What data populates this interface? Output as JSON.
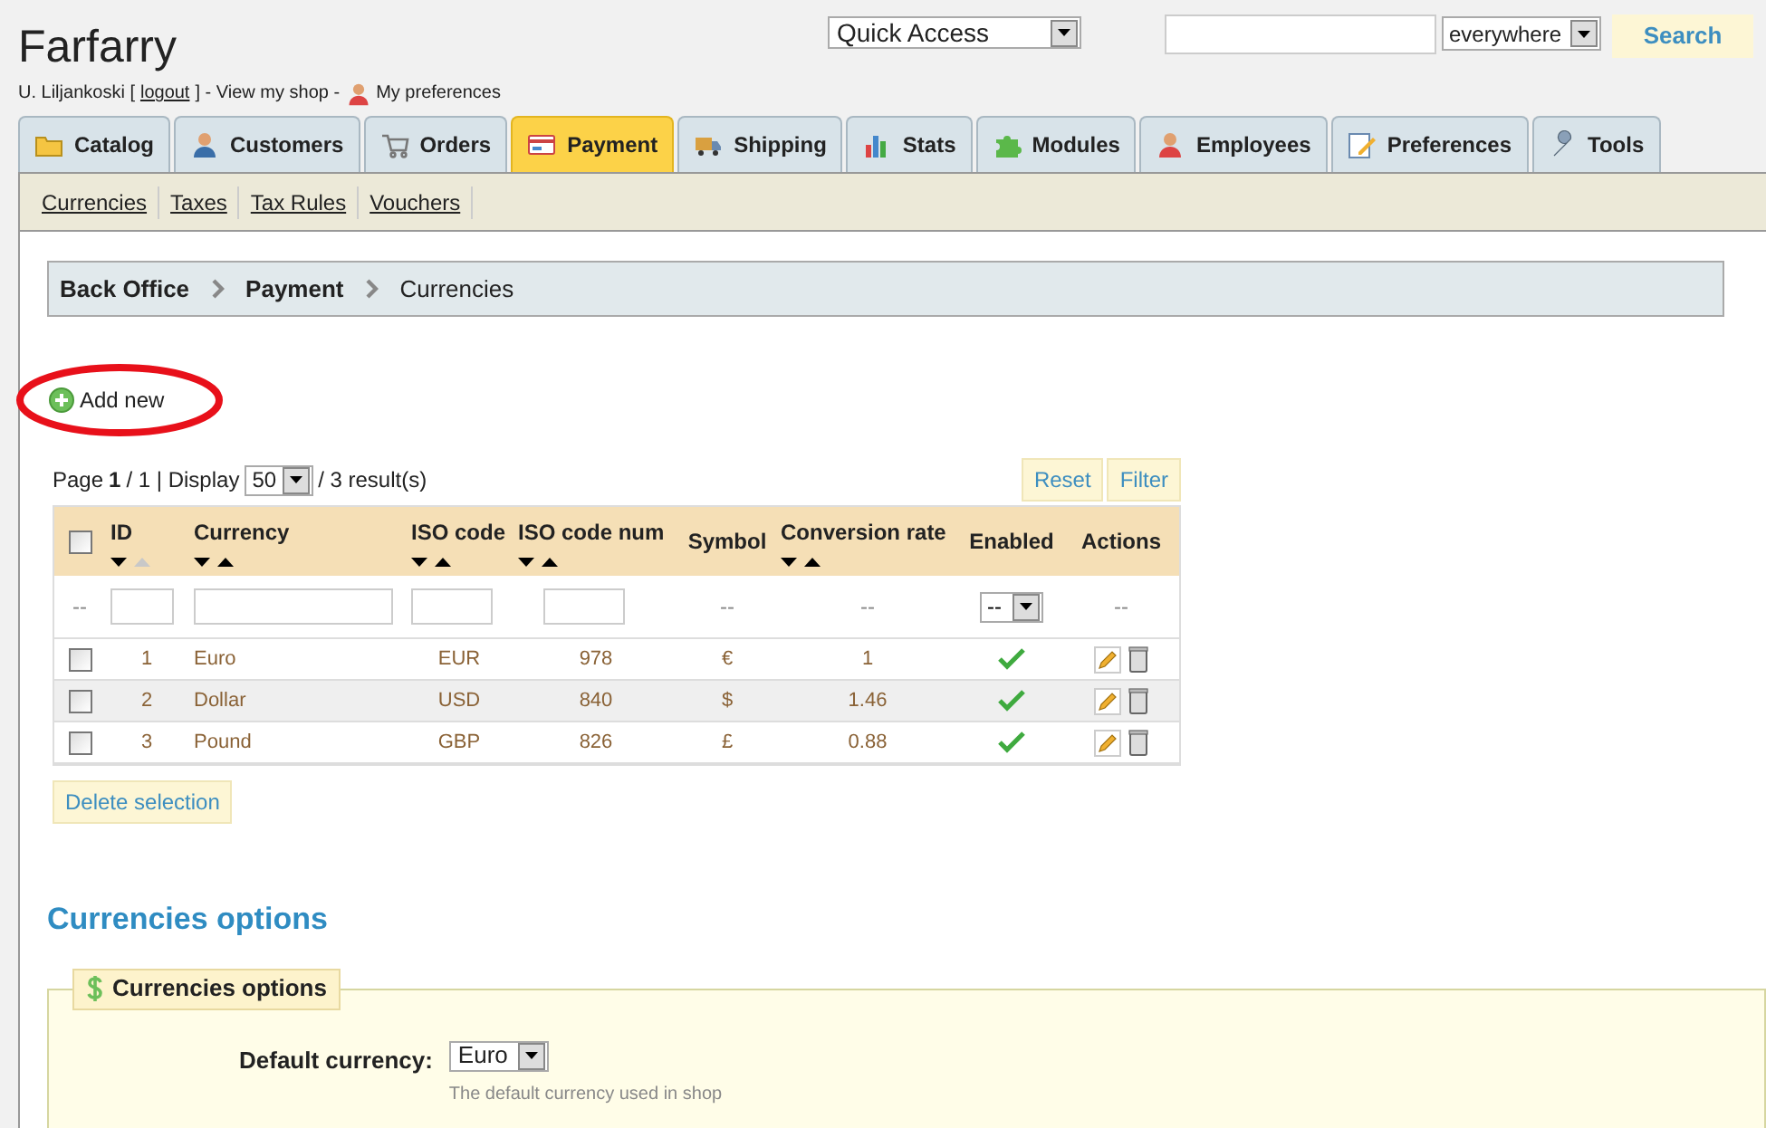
{
  "header": {
    "shop_name": "Farfarry",
    "quick_access": "Quick Access",
    "search_scope": "everywhere",
    "search_button": "Search",
    "user": "U. Liljankoski [",
    "logout": "logout",
    "user_after": "] - View my shop -",
    "preferences": "My preferences"
  },
  "tabs": [
    {
      "label": "Catalog",
      "selected": false
    },
    {
      "label": "Customers",
      "selected": false
    },
    {
      "label": "Orders",
      "selected": false
    },
    {
      "label": "Payment",
      "selected": true
    },
    {
      "label": "Shipping",
      "selected": false
    },
    {
      "label": "Stats",
      "selected": false
    },
    {
      "label": "Modules",
      "selected": false
    },
    {
      "label": "Employees",
      "selected": false
    },
    {
      "label": "Preferences",
      "selected": false
    },
    {
      "label": "Tools",
      "selected": false
    }
  ],
  "subtabs": [
    "Currencies",
    "Taxes",
    "Tax Rules",
    "Vouchers"
  ],
  "breadcrumb": [
    {
      "label": "Back Office",
      "current": false
    },
    {
      "label": "Payment",
      "current": false
    },
    {
      "label": "Currencies",
      "current": true
    }
  ],
  "add_new": "Add new",
  "pagination": {
    "page_label": "Page",
    "page": "1",
    "of": "/ 1 | Display",
    "per_page": "50",
    "results": "/ 3 result(s)"
  },
  "filter_buttons": [
    "Reset",
    "Filter"
  ],
  "table": {
    "select_all_checked": false,
    "columns": [
      {
        "label": "ID",
        "sortable": true,
        "sorted": true
      },
      {
        "label": "Currency",
        "sortable": true,
        "sorted": false
      },
      {
        "label": "ISO code",
        "sortable": true,
        "sorted": false
      },
      {
        "label": "ISO code num",
        "sortable": true,
        "sorted": false
      },
      {
        "label": "Symbol",
        "sortable": false
      },
      {
        "label": "Conversion rate",
        "sortable": true,
        "sorted": false
      },
      {
        "label": "Enabled",
        "sortable": false
      },
      {
        "label": "Actions",
        "sortable": false
      }
    ],
    "filter_row": {
      "select_placeholder": "--",
      "symbol": "--",
      "rate": "--",
      "enabled": "--",
      "actions": "--"
    },
    "rows": [
      {
        "checked": false,
        "id": "1",
        "currency": "Euro",
        "iso": "EUR",
        "iso_num": "978",
        "symbol": "€",
        "rate": "1",
        "enabled": true
      },
      {
        "checked": false,
        "id": "2",
        "currency": "Dollar",
        "iso": "USD",
        "iso_num": "840",
        "symbol": "$",
        "rate": "1.46",
        "enabled": true
      },
      {
        "checked": false,
        "id": "3",
        "currency": "Pound",
        "iso": "GBP",
        "iso_num": "826",
        "symbol": "£",
        "rate": "0.88",
        "enabled": true
      }
    ]
  },
  "delete_selection": "Delete selection",
  "options": {
    "heading": "Currencies options",
    "legend": "Currencies options",
    "default_label": "Default currency:",
    "default_value": "Euro",
    "hint": "The default currency used in shop"
  }
}
